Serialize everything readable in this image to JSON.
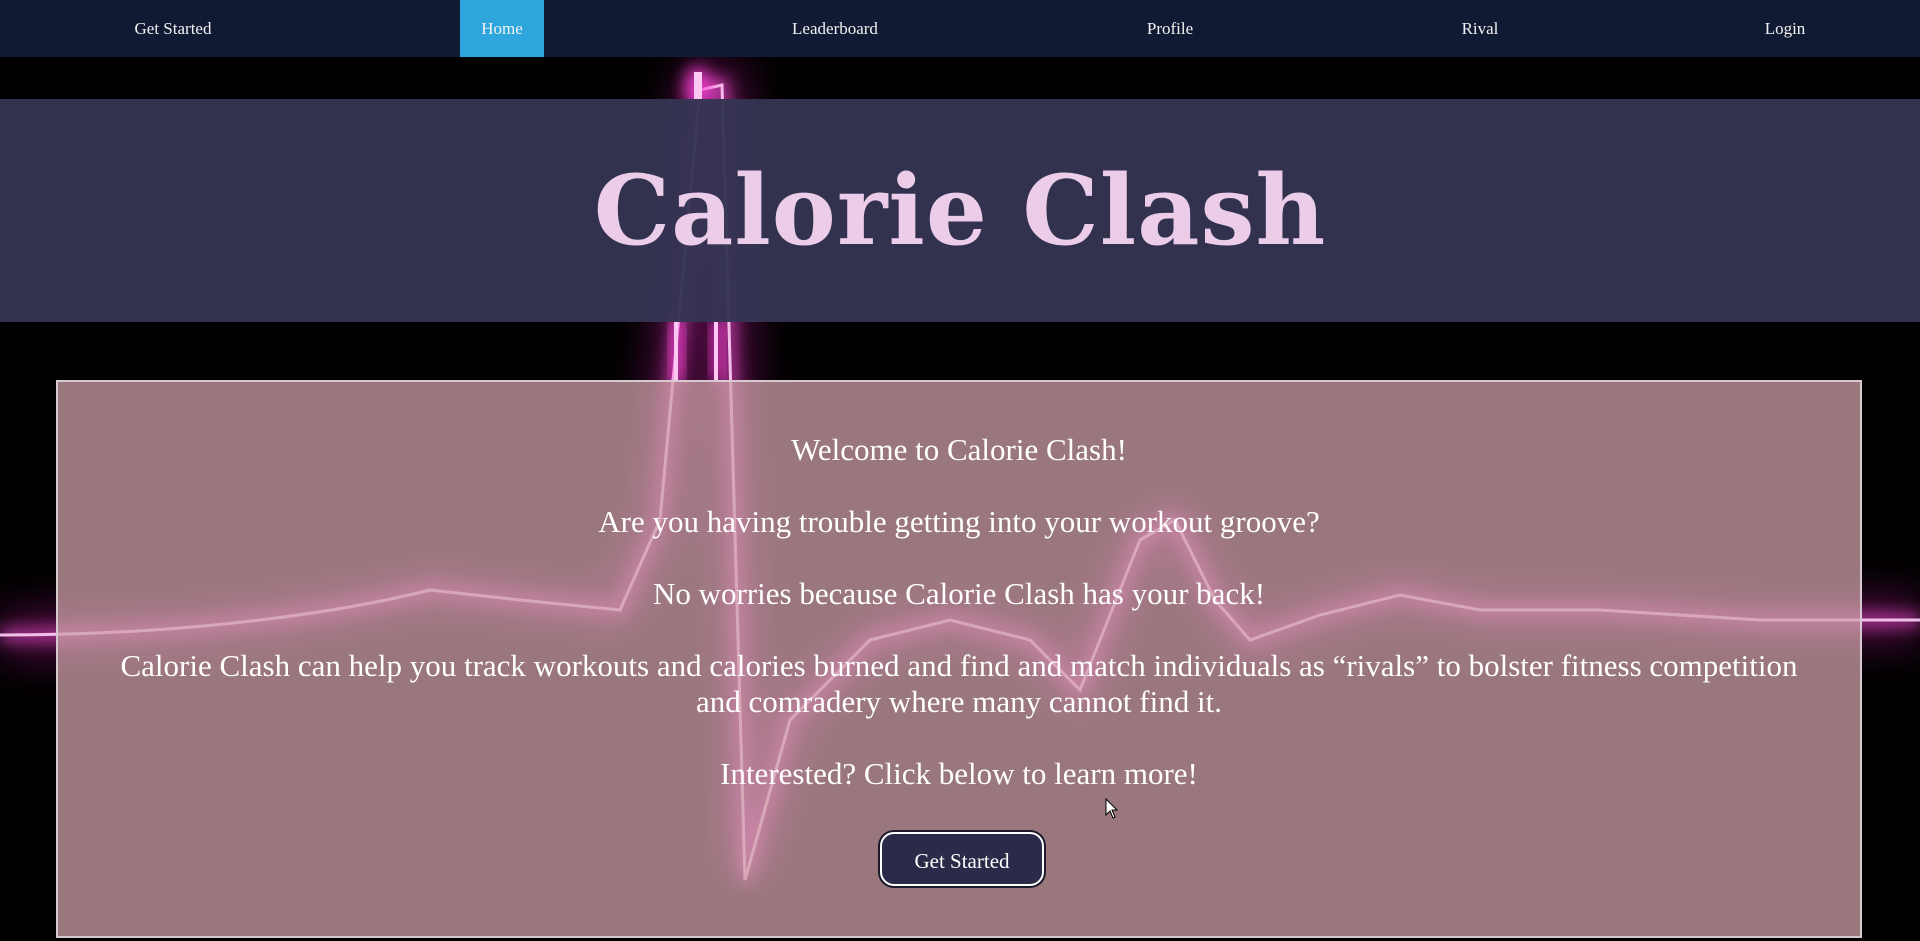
{
  "nav": {
    "items": [
      {
        "label": "Get Started"
      },
      {
        "label": "Home"
      },
      {
        "label": "Leaderboard"
      },
      {
        "label": "Profile"
      },
      {
        "label": "Rival"
      },
      {
        "label": "Login"
      }
    ],
    "active": "Home"
  },
  "hero": {
    "title": "Calorie Clash"
  },
  "content": {
    "welcome": "Welcome to Calorie Clash!",
    "question": "Are you having trouble getting into your workout groove?",
    "reassure": "No worries because Calorie Clash has your back!",
    "description": "Calorie Clash can help you track workouts and calories burned and find and match individuals as “rivals” to bolster fitness competition and comradery where many cannot find it.",
    "interest": "Interested? Click below to learn more!",
    "cta_label": "Get Started"
  },
  "colors": {
    "nav_bg": "#111a33",
    "nav_active": "#2ea5dc",
    "hero_bg": "#343452",
    "title_color": "#ebcdea",
    "content_bg": "#cea0a8",
    "neon": "#ff3fd8"
  },
  "icons": {
    "cursor": "mouse-pointer-icon",
    "background": "heartbeat-line-icon"
  }
}
